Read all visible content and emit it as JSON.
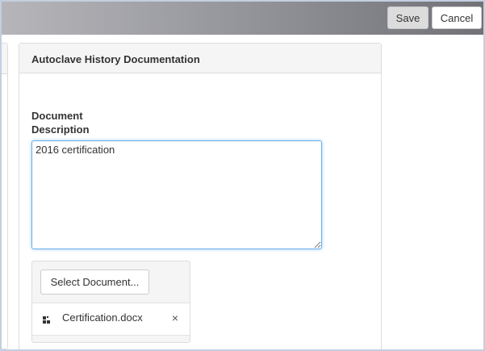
{
  "toolbar": {
    "save_label": "Save",
    "cancel_label": "Cancel"
  },
  "panel": {
    "title": "Autoclave History Documentation",
    "description_label": "Document Description",
    "description_value": "2016 certification"
  },
  "upload": {
    "select_label": "Select Document...",
    "files": [
      {
        "name": "Certification.docx",
        "remove_glyph": "×"
      }
    ]
  }
}
